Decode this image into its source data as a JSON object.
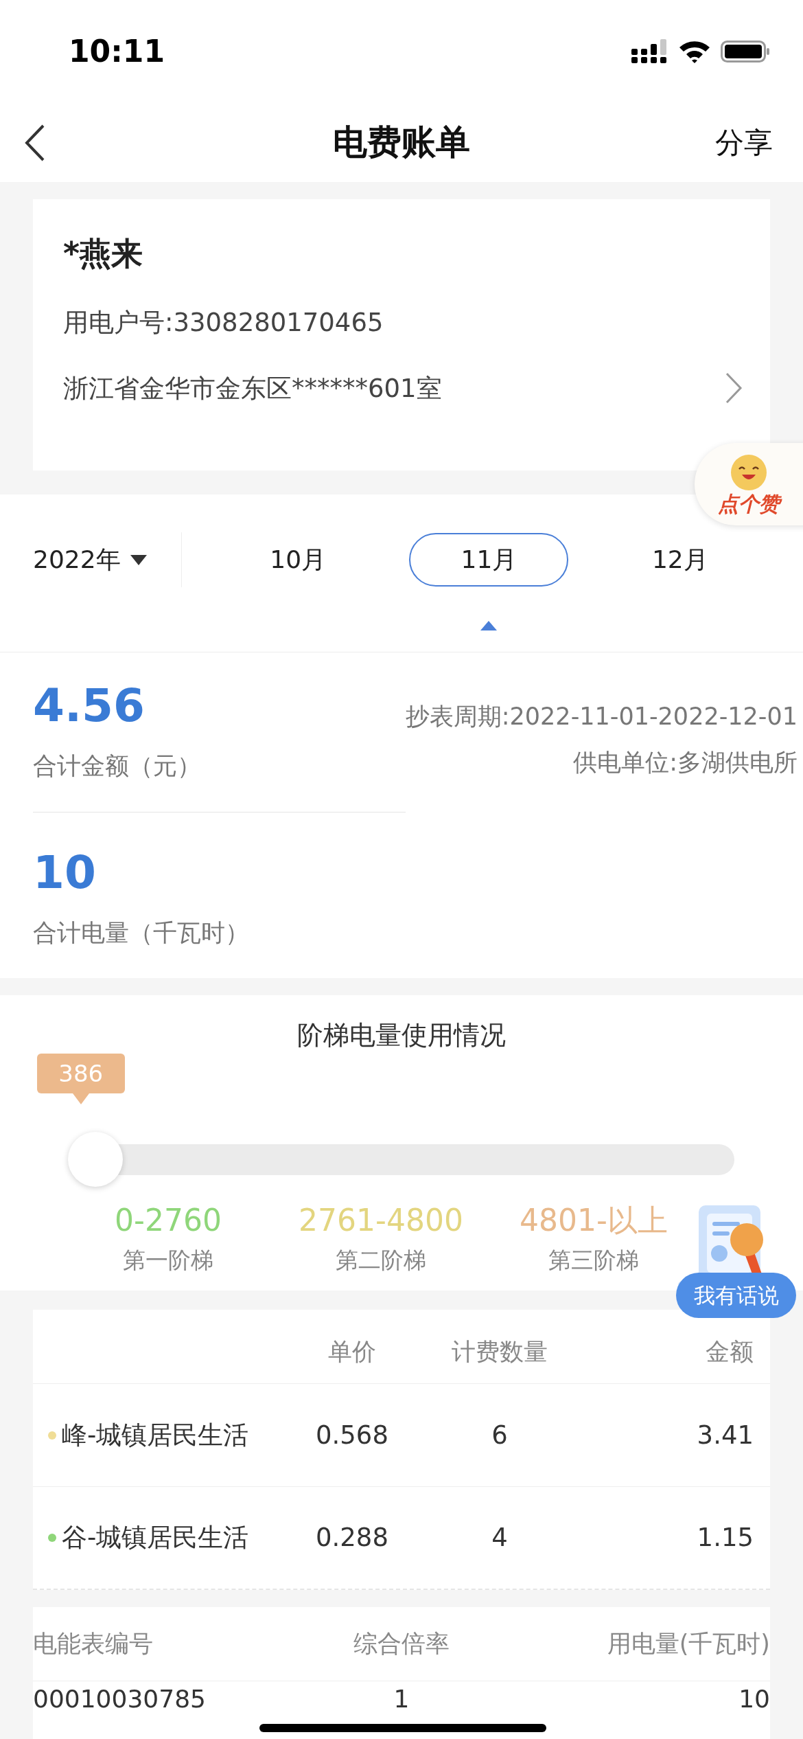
{
  "status_bar": {
    "time": "10:11"
  },
  "nav": {
    "title": "电费账单",
    "action": "分享"
  },
  "account": {
    "name": "*燕来",
    "number": "用电户号:3308280170465",
    "address": "浙江省金华市金东区******601室"
  },
  "like_badge": {
    "label": "点个赞"
  },
  "period": {
    "year": "2022年",
    "months": [
      {
        "label": "10月",
        "selected": false
      },
      {
        "label": "11月",
        "selected": true
      },
      {
        "label": "12月",
        "selected": false
      }
    ]
  },
  "summary": {
    "amount": "4.56",
    "amount_label": "合计金额（元）",
    "meter_period": "抄表周期:2022-11-01-2022-12-01",
    "supplier": "供电单位:多湖供电所",
    "usage": "10",
    "usage_label": "合计电量（千瓦时）"
  },
  "tiers": {
    "title": "阶梯电量使用情况",
    "reading": "386",
    "level": 0.04,
    "steps": [
      {
        "range": "0-2760",
        "name": "第一阶梯",
        "color": "#8fd67a"
      },
      {
        "range": "2761-4800",
        "name": "第二阶梯",
        "color": "#e3d57f"
      },
      {
        "range": "4801-以上",
        "name": "第三阶梯",
        "color": "#e8b98c"
      }
    ]
  },
  "feedback_badge": {
    "label": "我有话说"
  },
  "charges": {
    "columns": [
      "单价",
      "计费数量",
      "金额"
    ],
    "rows": [
      {
        "item": "峰-城镇居民生活",
        "price": "0.568",
        "quantity": "6",
        "amount": "3.41",
        "color": "#f0dd96"
      },
      {
        "item": "谷-城镇居民生活",
        "price": "0.288",
        "quantity": "4",
        "amount": "1.15",
        "color": "#8fd67a"
      }
    ]
  },
  "meters": {
    "columns": [
      "电能表编号",
      "综合倍率",
      "用电量(千瓦时)"
    ],
    "rows": [
      {
        "meter": "00010030785",
        "ratio": "1",
        "usage": "10"
      }
    ]
  }
}
